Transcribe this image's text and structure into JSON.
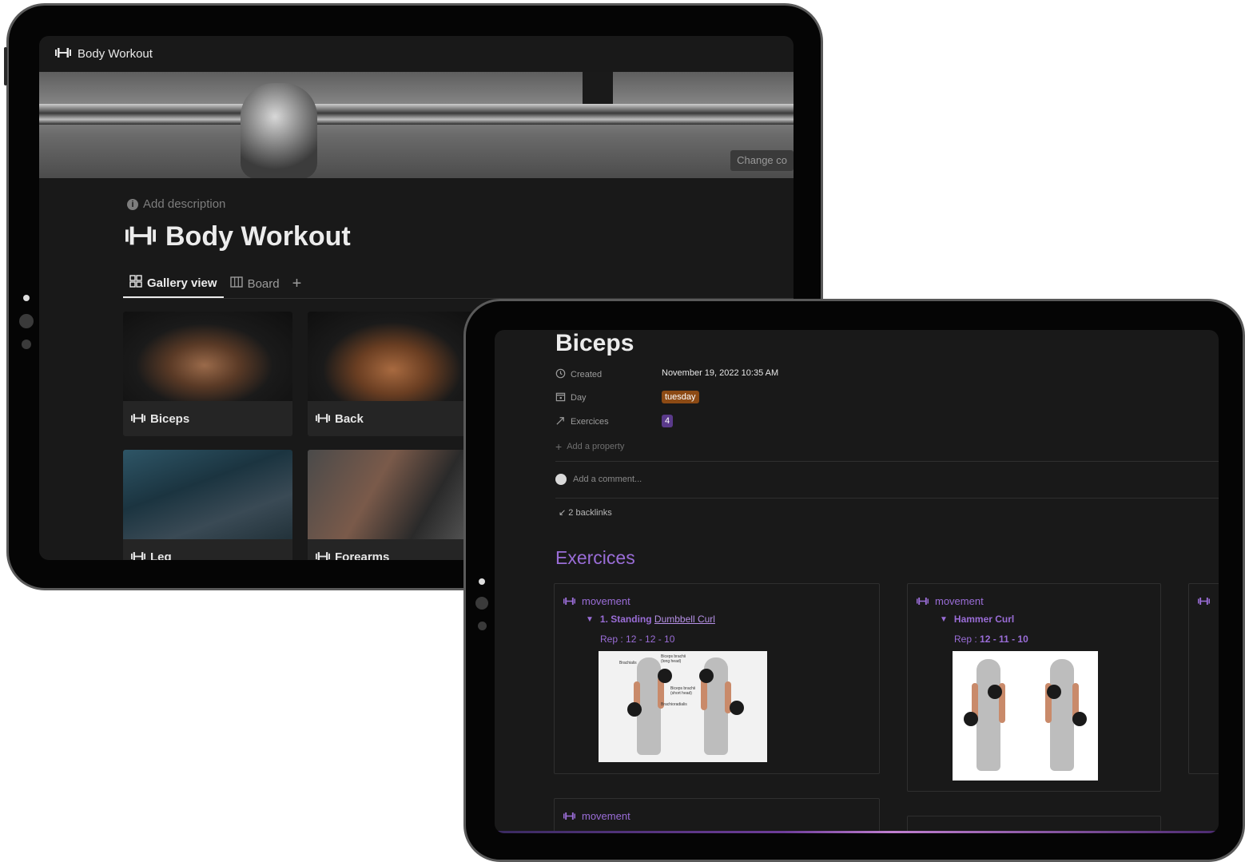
{
  "tablet1": {
    "topbar": {
      "icon": "dumbbell-icon",
      "title": "Body Workout"
    },
    "cover": {
      "change_button": "Change co"
    },
    "add_description": "Add description",
    "page_title": "Body Workout",
    "tabs": [
      {
        "icon": "gallery-icon",
        "label": "Gallery view",
        "active": true
      },
      {
        "icon": "board-icon",
        "label": "Board",
        "active": false
      }
    ],
    "tab_add": "+",
    "cards": [
      {
        "label": "Biceps"
      },
      {
        "label": "Back"
      },
      {
        "label": "Leg"
      },
      {
        "label": "Forearms"
      }
    ]
  },
  "tablet2": {
    "title": "Biceps",
    "properties": [
      {
        "icon": "clock-icon",
        "name": "Created",
        "value": "November 19, 2022 10:35 AM"
      },
      {
        "icon": "calendar-icon",
        "name": "Day",
        "value": "tuesday",
        "tag_color": "#8c4a14"
      },
      {
        "icon": "relation-arrow-icon",
        "name": "Exercices",
        "value": "4",
        "tag_color": "#5a3a8a"
      }
    ],
    "add_property": "Add a property",
    "add_comment": "Add a comment...",
    "backlinks": "2 backlinks",
    "section_heading": "Exercices",
    "exercises": [
      {
        "tag": "movement",
        "toggle_prefix": "1. Standing",
        "toggle_link": "Dumbbell Curl",
        "rep": "Rep : 12 - 12 - 10",
        "diagram_labels": [
          "Brachialis",
          "Biceps brachii (long head)",
          "Biceps brachii (short head)",
          "Brachioradialis"
        ]
      },
      {
        "tag": "movement",
        "toggle_prefix": "Hammer Curl",
        "toggle_link": "",
        "rep_prefix": "Rep :",
        "rep_values": "12 - 11 - 10"
      },
      {
        "tag": "movement"
      }
    ],
    "accent_color": "#9a6dd7"
  }
}
